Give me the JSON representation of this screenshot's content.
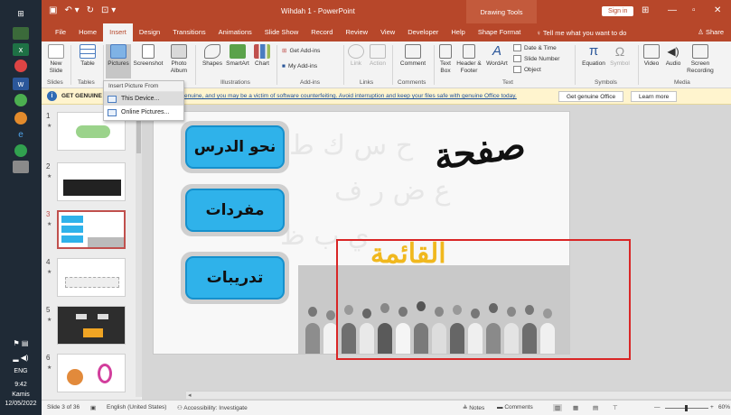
{
  "taskbar": {
    "icons": [
      "windows-logo",
      "file-icon",
      "excel-icon",
      "chrome-icon",
      "word-icon",
      "green-app-icon",
      "orange-app-icon",
      "edge-icon",
      "chrome2-icon",
      "misc-icon"
    ],
    "tray_lang": "ENG",
    "time": "9:42",
    "day": "Kamis",
    "date": "12/05/2022"
  },
  "titlebar": {
    "title": "Wihdah 1  -  PowerPoint",
    "context": "Drawing Tools",
    "signin": "Sign in"
  },
  "tabs": [
    "File",
    "Home",
    "Insert",
    "Design",
    "Transitions",
    "Animations",
    "Slide Show",
    "Record",
    "Review",
    "View",
    "Developer",
    "Help",
    "Shape Format"
  ],
  "active_tab": "Insert",
  "tellme": "Tell me what you want to do",
  "share": "Share",
  "ribbon": {
    "slides": {
      "new_slide": "New Slide",
      "label": "Slides"
    },
    "tables": {
      "table": "Table",
      "label": "Tables"
    },
    "images": {
      "pictures": "Pictures",
      "screenshot": "Screenshot",
      "photo_album": "Photo Album"
    },
    "illustrations": {
      "shapes": "Shapes",
      "smartart": "SmartArt",
      "chart": "Chart",
      "label": "Illustrations"
    },
    "addins": {
      "get": "Get Add-ins",
      "my": "My Add-ins",
      "label": "Add-ins"
    },
    "links": {
      "link": "Link",
      "action": "Action",
      "label": "Links"
    },
    "comments": {
      "comment": "Comment",
      "label": "Comments"
    },
    "text": {
      "textbox": "Text Box",
      "header": "Header & Footer",
      "wordart": "WordArt",
      "datetime": "Date & Time",
      "slidenumber": "Slide Number",
      "object": "Object",
      "label": "Text"
    },
    "symbols": {
      "equation": "Equation",
      "symbol": "Symbol",
      "label": "Symbols"
    },
    "media": {
      "video": "Video",
      "audio": "Audio",
      "screen": "Screen Recording",
      "label": "Media"
    }
  },
  "dropdown": {
    "header": "Insert Picture From",
    "items": [
      "This Device...",
      "Online Pictures..."
    ]
  },
  "notification": {
    "lead": "GET GENUINE O",
    "message": "enuine, and you may be a victim of software counterfeiting. Avoid interruption and keep your files safe with genuine Office today.",
    "btn1": "Get genuine Office",
    "btn2": "Learn more"
  },
  "thumbnails": [
    {
      "num": "1"
    },
    {
      "num": "2"
    },
    {
      "num": "3"
    },
    {
      "num": "4"
    },
    {
      "num": "5"
    },
    {
      "num": "6"
    }
  ],
  "slide": {
    "menu": [
      "نحو الدرس",
      "مفردات",
      "تدريبات"
    ],
    "title": "صفحة",
    "subtitle": "القائمة"
  },
  "status": {
    "slide_of": "Slide 3 of 36",
    "language": "English (United States)",
    "accessibility": "Accessibility: Investigate",
    "notes": "Notes",
    "comments": "Comments",
    "zoom": "60%"
  }
}
